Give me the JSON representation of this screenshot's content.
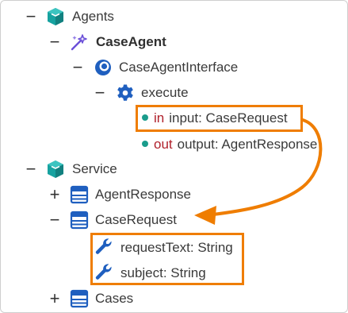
{
  "tree": {
    "agents": {
      "label": "Agents",
      "toggle": "−"
    },
    "case_agent": {
      "label": "CaseAgent",
      "toggle": "−"
    },
    "case_agent_interface": {
      "label": "CaseAgentInterface",
      "toggle": "−"
    },
    "execute": {
      "label": "execute",
      "toggle": "−"
    },
    "param_in": {
      "direction": "in",
      "text": "input: CaseRequest"
    },
    "param_out": {
      "direction": "out",
      "text": "output: AgentResponse"
    },
    "service": {
      "label": "Service",
      "toggle": "−"
    },
    "agent_response": {
      "label": "AgentResponse",
      "toggle": "+"
    },
    "case_request": {
      "label": "CaseRequest",
      "toggle": "−"
    },
    "field_request_text": {
      "label": "requestText: String"
    },
    "field_subject": {
      "label": "subject: String"
    },
    "cases": {
      "label": "Cases",
      "toggle": "+"
    }
  },
  "colors": {
    "highlight": "#ef7d00",
    "package_icon": "#17a2a0",
    "class_icon": "#1f5fbf",
    "direction": "#b0202b",
    "dot": "#1a9c8c"
  },
  "icons": {
    "package": "cube-icon",
    "agent": "sparkle-wand-icon",
    "interface": "interface-circle-icon",
    "operation": "gear-icon",
    "class": "class-table-icon",
    "attribute": "wrench-icon"
  }
}
